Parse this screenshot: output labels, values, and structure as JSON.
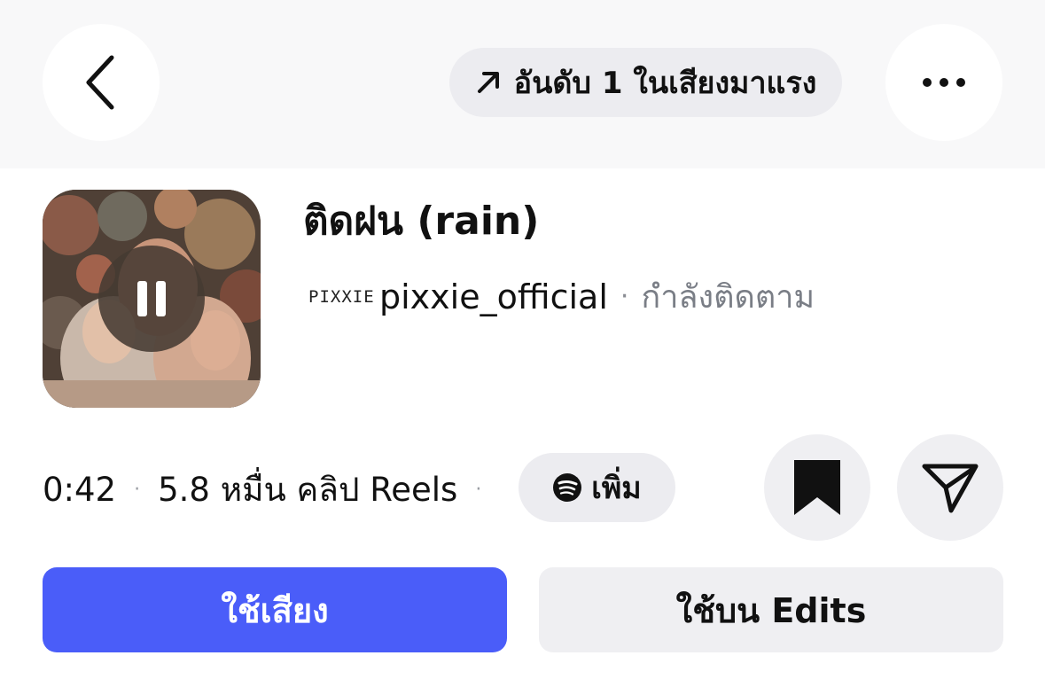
{
  "header": {
    "back_icon": "chevron-left-icon",
    "trend_icon": "arrow-up-right-icon",
    "trend_label": "อันดับ 1 ในเสียงมาแรง",
    "more_icon": "more-horizontal-icon"
  },
  "track": {
    "title": "ติดฝน (rain)",
    "artist_logo_text": "PIXXIE",
    "artist": "pixxie_official",
    "separator": "·",
    "follow_status": "กำลังติดตาม",
    "playback_state_icon": "pause-icon"
  },
  "stats": {
    "duration": "0:42",
    "separator": "·",
    "reels_count": "5.8 หมื่น คลิป Reels",
    "spotify_icon": "spotify-icon",
    "add_label": "เพิ่ม"
  },
  "actions": {
    "save_icon": "bookmark-icon",
    "share_icon": "send-icon",
    "use_audio_label": "ใช้เสียง",
    "use_in_edits_label": "ใช้บน Edits"
  },
  "colors": {
    "primary_button": "#4a5df9",
    "secondary_button": "#efeff2",
    "muted_text": "#7a7e86"
  }
}
